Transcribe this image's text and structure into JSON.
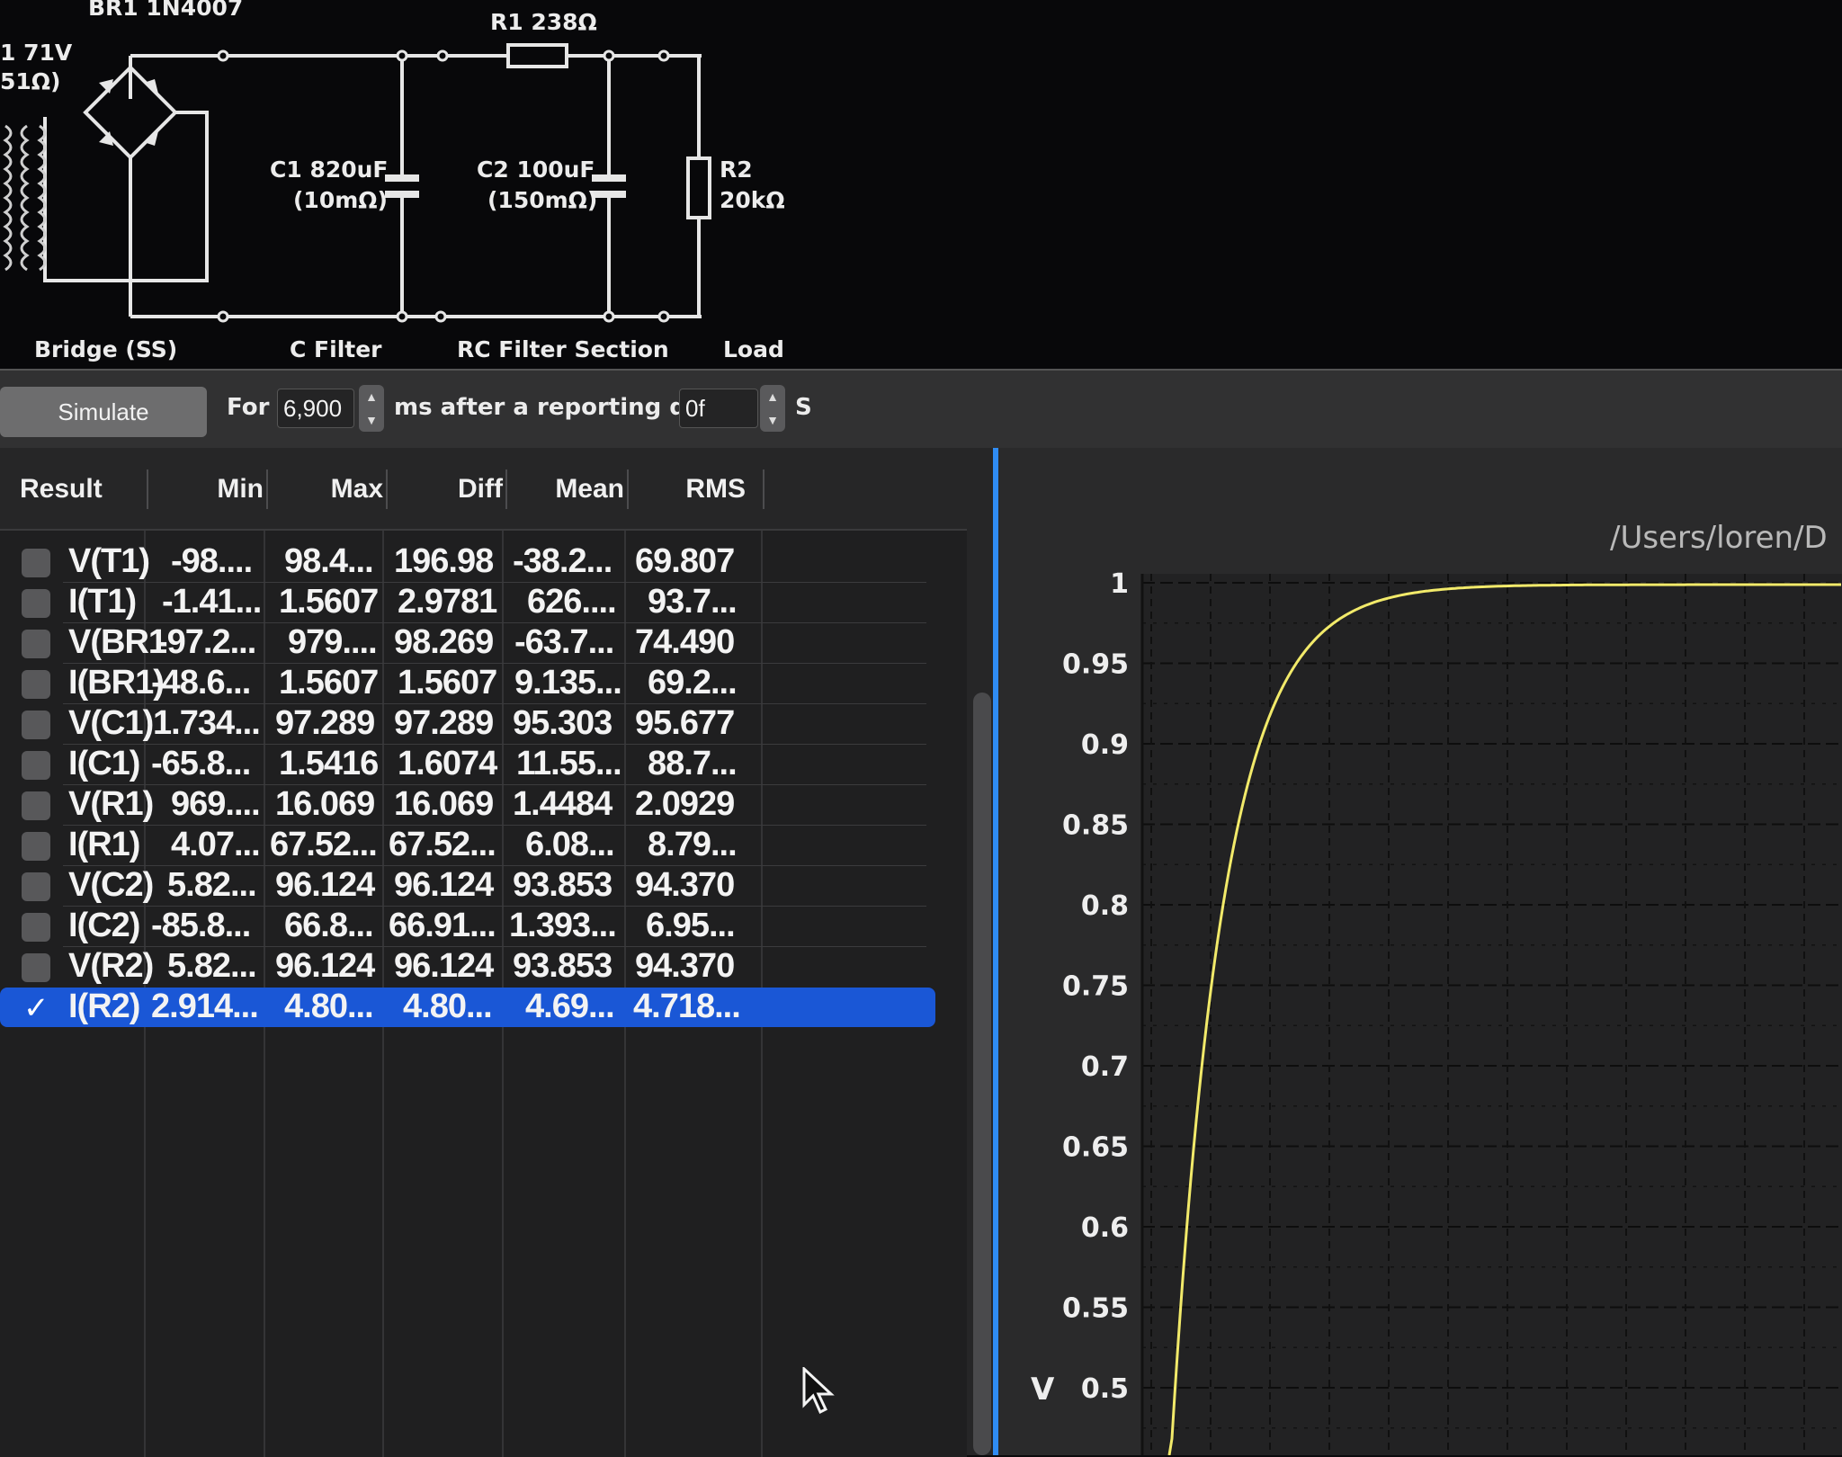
{
  "schematic": {
    "source_label_1": "1 71V",
    "source_label_2": "51Ω)",
    "bridge_title": "BR1 1N4007",
    "r1_label": "R1 238Ω",
    "c1_label_1": "C1 820uF",
    "c1_label_2": "(10mΩ)",
    "c2_label_1": "C2 100uF",
    "c2_label_2": "(150mΩ)",
    "r2_label_1": "R2",
    "r2_label_2": "20kΩ",
    "section_bridge": "Bridge (SS)",
    "section_cfilter": "C Filter",
    "section_rc": "RC Filter Section",
    "section_load": "Load"
  },
  "toolbar": {
    "simulate_label": "Simulate",
    "for_label": "For",
    "duration_value": "6,900",
    "ms_label": "ms after a reporting delay",
    "delay_value": "0f",
    "s_label": "S"
  },
  "table": {
    "headers": [
      "Result",
      "Min",
      "Max",
      "Diff",
      "Mean",
      "RMS"
    ],
    "rows": [
      {
        "name": "V(T1)",
        "min": "-98....",
        "max": "98.4...",
        "diff": "196.98",
        "mean": "-38.2...",
        "rms": "69.807",
        "checked": false
      },
      {
        "name": "I(T1)",
        "min": "-1.41...",
        "max": "1.5607",
        "diff": "2.9781",
        "mean": "626....",
        "rms": "93.7...",
        "checked": false
      },
      {
        "name": "V(BR1",
        "min": "-97.2...",
        "max": "979....",
        "diff": "98.269",
        "mean": "-63.7...",
        "rms": "74.490",
        "checked": false
      },
      {
        "name": "I(BR1)",
        "min": "-48.6...",
        "max": "1.5607",
        "diff": "1.5607",
        "mean": "9.135...",
        "rms": "69.2...",
        "checked": false
      },
      {
        "name": "V(C1)",
        "min": "1.734...",
        "max": "97.289",
        "diff": "97.289",
        "mean": "95.303",
        "rms": "95.677",
        "checked": false
      },
      {
        "name": "I(C1)",
        "min": "-65.8...",
        "max": "1.5416",
        "diff": "1.6074",
        "mean": "11.55...",
        "rms": "88.7...",
        "checked": false
      },
      {
        "name": "V(R1)",
        "min": "969....",
        "max": "16.069",
        "diff": "16.069",
        "mean": "1.4484",
        "rms": "2.0929",
        "checked": false
      },
      {
        "name": "I(R1)",
        "min": "4.07...",
        "max": "67.52...",
        "diff": "67.52...",
        "mean": "6.08...",
        "rms": "8.79...",
        "checked": false
      },
      {
        "name": "V(C2)",
        "min": "5.82...",
        "max": "96.124",
        "diff": "96.124",
        "mean": "93.853",
        "rms": "94.370",
        "checked": false
      },
      {
        "name": "I(C2)",
        "min": "-85.8...",
        "max": "66.8...",
        "diff": "66.91...",
        "mean": "1.393...",
        "rms": "6.95...",
        "checked": false
      },
      {
        "name": "V(R2)",
        "min": "5.82...",
        "max": "96.124",
        "diff": "96.124",
        "mean": "93.853",
        "rms": "94.370",
        "checked": false
      },
      {
        "name": "I(R2)",
        "min": "2.914...",
        "max": "4.80...",
        "diff": "4.80...",
        "mean": "4.69...",
        "rms": "4.718...",
        "checked": true
      }
    ]
  },
  "plot": {
    "title": "/Users/loren/D",
    "ylabel": "V",
    "yticks": [
      "1",
      "0.95",
      "0.9",
      "0.85",
      "0.8",
      "0.75",
      "0.7",
      "0.65",
      "0.6",
      "0.55",
      "0.5"
    ],
    "line_color": "#f2ea6a",
    "grid_color": "#111111",
    "background": "#2a2a2b"
  },
  "colors": {
    "selection": "#1a57d6",
    "accent_border": "#2f8cf3"
  }
}
